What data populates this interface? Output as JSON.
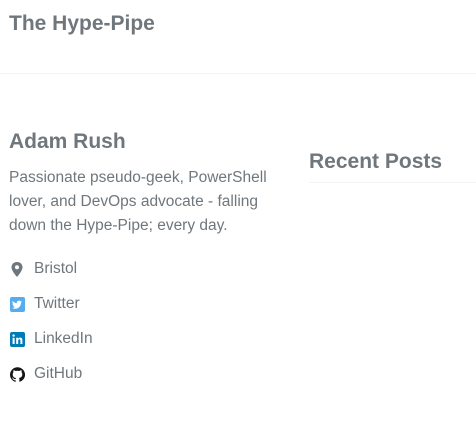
{
  "masthead": {
    "site_title": "The Hype-Pipe"
  },
  "author": {
    "name": "Adam Rush",
    "bio": "Passionate pseudo-geek, PowerShell lover, and DevOps advocate - falling down the Hype-Pipe; every day.",
    "links": [
      {
        "label": "Bristol",
        "icon": "location-pin-icon",
        "color": "#6f777d"
      },
      {
        "label": "Twitter",
        "icon": "twitter-icon",
        "color": "#55acee"
      },
      {
        "label": "LinkedIn",
        "icon": "linkedin-icon",
        "color": "#007bb6"
      },
      {
        "label": "GitHub",
        "icon": "github-icon",
        "color": "#171516"
      }
    ]
  },
  "sidebar": {
    "recent_posts_title": "Recent Posts"
  }
}
